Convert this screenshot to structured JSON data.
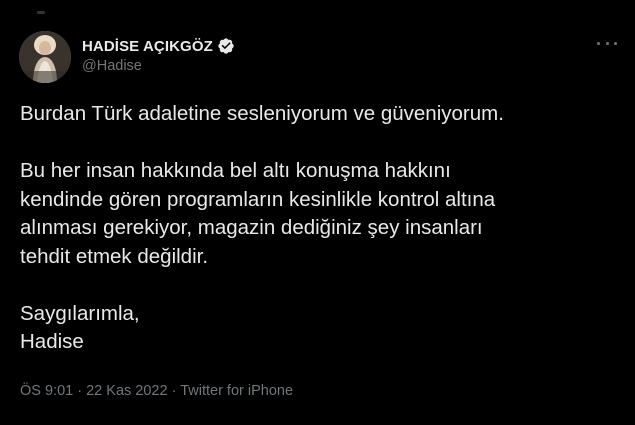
{
  "tweet": {
    "author": {
      "display_name": "HADİSE AÇIKGÖZ",
      "handle": "@Hadise",
      "verified": true
    },
    "paragraphs": [
      [
        "Burdan Türk adaletine sesleniyorum ve güveniyorum."
      ],
      [
        "Bu her insan hakkında bel altı konuşma hakkını",
        "kendinde gören programların kesinlikle kontrol altına",
        "alınması gerekiyor, magazin dediğiniz şey insanları",
        "tehdit etmek değildir."
      ],
      [
        "Saygılarımla,",
        "Hadise"
      ]
    ],
    "meta": {
      "time": "ÖS 9:01",
      "separator": "·",
      "date": "22 Kas 2022",
      "source": "Twitter for iPhone"
    }
  },
  "icons": {
    "verified": "verified-badge-icon",
    "more": "more-horizontal-icon"
  },
  "colors": {
    "background": "#000000",
    "text_primary": "#e7e9ea",
    "text_secondary": "#71767b"
  }
}
